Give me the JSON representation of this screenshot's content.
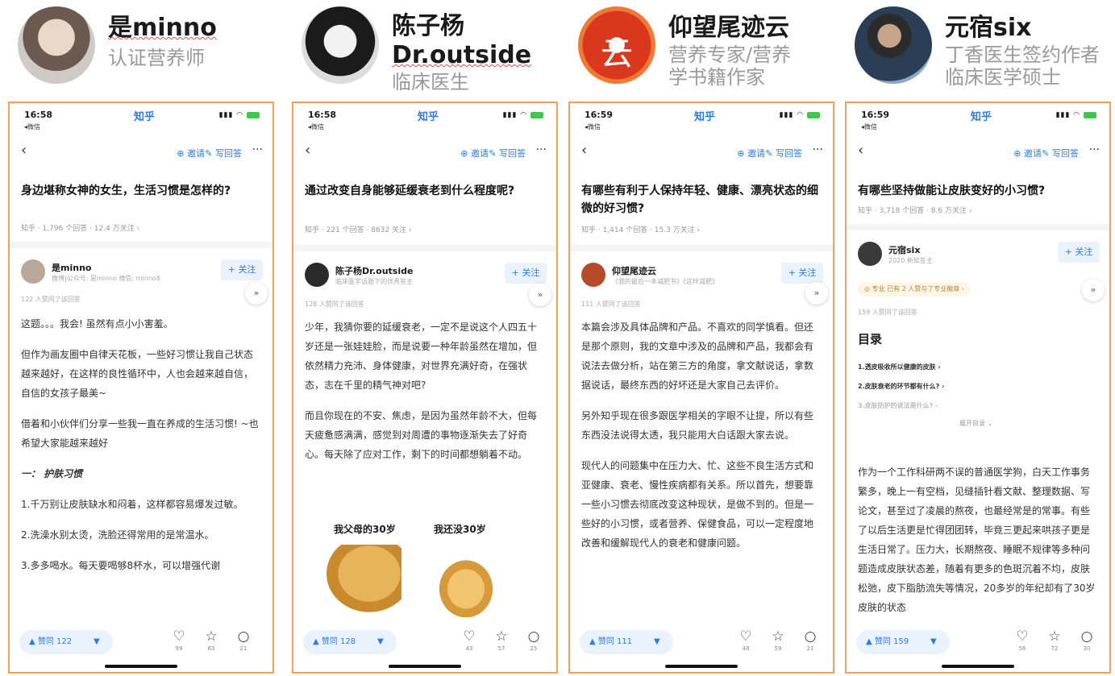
{
  "colors": {
    "accent": "#2a7de1",
    "border": "#f0a060"
  },
  "profiles": [
    {
      "name": "是minno",
      "sub1": "认证营养师",
      "sub2": ""
    },
    {
      "name": "陈子杨",
      "sub1": "Dr.outside",
      "sub2": "临床医生"
    },
    {
      "name": "仰望尾迹云",
      "sub1": "营养专家/营养",
      "sub2": "学书籍作家"
    },
    {
      "name": "元宿six",
      "sub1": "丁香医生签约作者",
      "sub2": "临床医学硕士"
    }
  ],
  "phones": [
    {
      "time": "16:58",
      "app": "知乎",
      "back": "◂微信",
      "nav_invite": "邀请",
      "nav_answer": "写回答",
      "question": "身边堪称女神的女生，生活习惯是怎样的?",
      "qmeta": "知乎 · 1,796 个回答 · 12.4 万关注 ›",
      "author_name": "是minno",
      "author_desc": "微博|公众号: 是minno 微信: minno8",
      "follow": "+ 关注",
      "upvoters": "122 人赞同了该回答",
      "paras": [
        "这题。。。我会! 虽然有点小小害羞。",
        "但作为画友圈中自律天花板，一些好习惯让我自己状态越来越好，在这样的良性循环中，人也会越来越自信，自信的女孩子最美~",
        "借着和小伙伴们分享一些我一直在养成的生活习惯! ~也希望大家能越来越好",
        "一： 护肤习惯",
        "1.千万别让皮肤缺水和闷着，这样都容易爆发过敏。",
        "2.洗澡水别太烫，洗脸还得常用的是常温水。",
        "3.多多喝水。每天要喝够8杯水，可以增强代谢"
      ],
      "vote": "赞同 122",
      "likes": "99",
      "favs": "63",
      "comments": "21"
    },
    {
      "time": "16:58",
      "app": "知乎",
      "back": "◂微信",
      "nav_invite": "邀请",
      "nav_answer": "写回答",
      "question": "通过改变自身能够延缓衰老到什么程度呢?",
      "qmeta": "知乎 · 221 个回答 · 8632 关注 ›",
      "author_name": "陈子杨Dr.outside",
      "author_desc": "临床医学话题下的优秀答主",
      "follow": "+ 关注",
      "upvoters": "128 人赞同了该回答",
      "paras": [
        "少年，我猜你要的延缓衰老，一定不是说这个人四五十岁还是一张娃娃脸，而是说要一种年龄虽然在增加，但依然精力充沛、身体健康，对世界充满好奇，在强状态，志在千里的精气神对吧?",
        "而且你现在的不安、焦虑，是因为虽然年龄不大，但每天疲惫感满满，感觉到对周遭的事物逐渐失去了好奇心。每天除了应对工作，剩下的时间都想躺着不动。"
      ],
      "meme_left": "我父母的30岁",
      "meme_right": "我还没30岁",
      "vote": "赞同 128",
      "likes": "43",
      "favs": "57",
      "comments": "25"
    },
    {
      "time": "16:59",
      "app": "知乎",
      "back": "◂微信",
      "nav_invite": "邀请",
      "nav_answer": "写回答",
      "question": "有哪些有利于人保持年轻、健康、漂亮状态的细微的好习惯?",
      "qmeta": "知乎 · 1,414 个回答 · 15.3 万关注 ›",
      "author_name": "仰望尾迹云",
      "author_desc": "《我的最后一本减肥书》《这样减肥》",
      "follow": "+ 关注",
      "upvoters": "111 人赞同了该回答",
      "paras": [
        "本篇会涉及具体品牌和产品。不喜欢的同学慎看。但还是那个原则，我的文章中涉及的品牌和产品，我都会有说法去做分析，站在第三方的角度，拿文献说话，拿数据说话，最终东西的好坏还是大家自己去评价。",
        "另外知乎现在很多跟医学相关的字眼不让提，所以有些东西没法说得太透，我只能用大白话跟大家去说。",
        "现代人的问题集中在压力大、忙、这些不良生活方式和亚健康、衰老、慢性疾病都有关系。所以首先，想要靠一些小习惯去彻底改变这种现状，是做不到的。但是一些好的小习惯，或者营养、保健食品，可以一定程度地改善和缓解现代人的衰老和健康问题。"
      ],
      "vote": "赞同 111",
      "likes": "48",
      "favs": "59",
      "comments": "21"
    },
    {
      "time": "16:59",
      "app": "知乎",
      "back": "◂微信",
      "nav_invite": "邀请",
      "nav_answer": "写回答",
      "question": "有哪些坚持做能让皮肤变好的小习惯?",
      "qmeta": "知乎 · 3,718 个回答 · 8.6 万关注 ›",
      "author_name": "元宿six",
      "author_desc": "2020 新知答主",
      "follow": "+ 关注",
      "chip": "◎ 专业 已有 2 人赞与了专业徽章 ›",
      "upvoters": "159 人赞同了该回答",
      "toc_title": "目录",
      "toc": [
        "1.透皮吸收所以健康的皮肤 ›",
        "2.皮肤衰老的环节都有什么? ›",
        "3.皮肤防护的说法是什么? ›"
      ],
      "toc_expand": "展开目录 ⌄",
      "paras": [
        "作为一个工作科研两不误的普通医学狗，白天工作事务繁多，晚上一有空档，见缝插针看文献、整理数据、写论文，甚至过了凌晨的熬夜，也最经常是的常事。有些了以后生活更是忙得团团转，毕竟三更起来哄孩子更是生活日常了。压力大，长期熬夜、睡眠不规律等多种问题造成皮肤状态差，随着有更多的色斑沉着不均，皮肤松弛，皮下脂肪流失等情况，20多岁的年纪却有了30岁皮肤的状态"
      ],
      "vote": "赞同 159",
      "likes": "56",
      "favs": "72",
      "comments": "30"
    }
  ]
}
